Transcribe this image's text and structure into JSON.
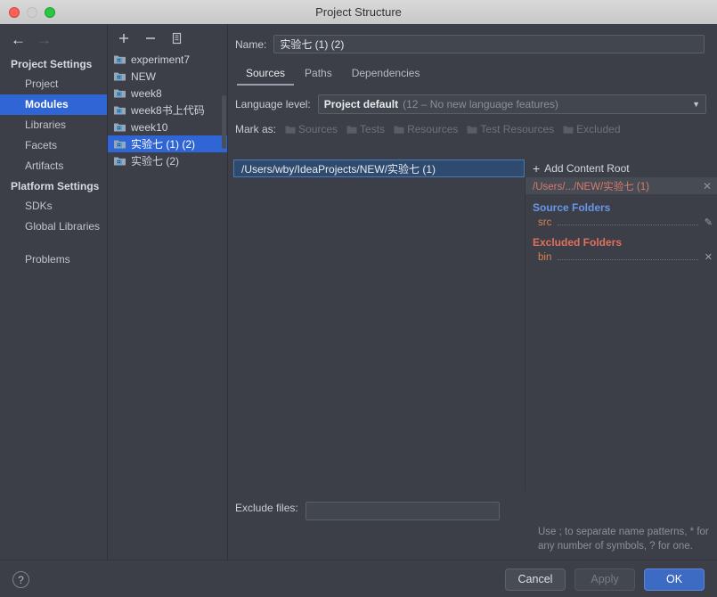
{
  "window": {
    "title": "Project Structure",
    "traffic": [
      "close",
      "minimize",
      "zoom"
    ]
  },
  "nav": {
    "back_icon": "arrow-left-icon",
    "forward_icon": "arrow-right-icon"
  },
  "sidebar": {
    "groups": [
      {
        "label": "Project Settings",
        "items": [
          {
            "label": "Project",
            "selected": false
          },
          {
            "label": "Modules",
            "selected": true
          },
          {
            "label": "Libraries",
            "selected": false
          },
          {
            "label": "Facets",
            "selected": false
          },
          {
            "label": "Artifacts",
            "selected": false
          }
        ]
      },
      {
        "label": "Platform Settings",
        "items": [
          {
            "label": "SDKs",
            "selected": false
          },
          {
            "label": "Global Libraries",
            "selected": false
          }
        ]
      }
    ],
    "problems": "Problems"
  },
  "modules": {
    "toolbar": {
      "add": "add-icon",
      "remove": "remove-icon",
      "copy": "copy-icon"
    },
    "items": [
      {
        "label": "experiment7",
        "selected": false
      },
      {
        "label": "NEW",
        "selected": false
      },
      {
        "label": "week8",
        "selected": false
      },
      {
        "label": "week8书上代码",
        "selected": false
      },
      {
        "label": "week10",
        "selected": false
      },
      {
        "label": "实验七 (1) (2)",
        "selected": true
      },
      {
        "label": "实验七 (2)",
        "selected": false
      }
    ]
  },
  "main": {
    "name_label": "Name:",
    "name_value": "实验七 (1) (2)",
    "tabs": [
      {
        "label": "Sources",
        "active": true
      },
      {
        "label": "Paths",
        "active": false
      },
      {
        "label": "Dependencies",
        "active": false
      }
    ],
    "language_level_label": "Language level:",
    "language_level_value": "Project default",
    "language_level_detail": "(12 – No new language features)",
    "mark_as_label": "Mark as:",
    "mark_as_buttons": [
      {
        "label": "Sources",
        "mnemonic": "S",
        "rest": "ources",
        "enabled": false
      },
      {
        "label": "Tests",
        "mnemonic": "T",
        "rest": "ests",
        "enabled": false
      },
      {
        "label": "Resources",
        "mnemonic": "R",
        "rest": "esources",
        "enabled": false
      },
      {
        "label": "Test Resources",
        "mnemonic": "e",
        "rest": "st Resources",
        "prefix": "T",
        "enabled": false
      },
      {
        "label": "Excluded",
        "mnemonic": "E",
        "rest": "xcluded",
        "enabled": false
      }
    ],
    "content_root_path": "/Users/wby/IdeaProjects/NEW/实验七 (1)",
    "add_content_root": "Add Content Root",
    "add_content_root_mnemonic": "C",
    "root_header": "/Users/.../NEW/实验七 (1)",
    "root_close_icon": "close-icon",
    "source_folders_title": "Source Folders",
    "source_folders": [
      {
        "name": "src",
        "action_icon": "edit-pencil-icon"
      }
    ],
    "excluded_folders_title": "Excluded Folders",
    "excluded_folders": [
      {
        "name": "bin",
        "action_icon": "close-icon"
      }
    ],
    "exclude_files_label": "Exclude files:",
    "exclude_files_value": "",
    "exclude_hint": "Use ; to separate name patterns, * for any number of symbols, ? for one."
  },
  "footer": {
    "help_icon": "?",
    "buttons": [
      {
        "label": "Cancel",
        "style": "default"
      },
      {
        "label": "Apply",
        "style": "disabled"
      },
      {
        "label": "OK",
        "style": "primary"
      }
    ]
  },
  "colors": {
    "accent_selection": "#2f65d4",
    "primary_button": "#3d6bc4",
    "panel_bg": "#3c3f47",
    "source_blue": "#6897ea",
    "excluded_red": "#e0705d",
    "folder_orange": "#d9834f"
  }
}
